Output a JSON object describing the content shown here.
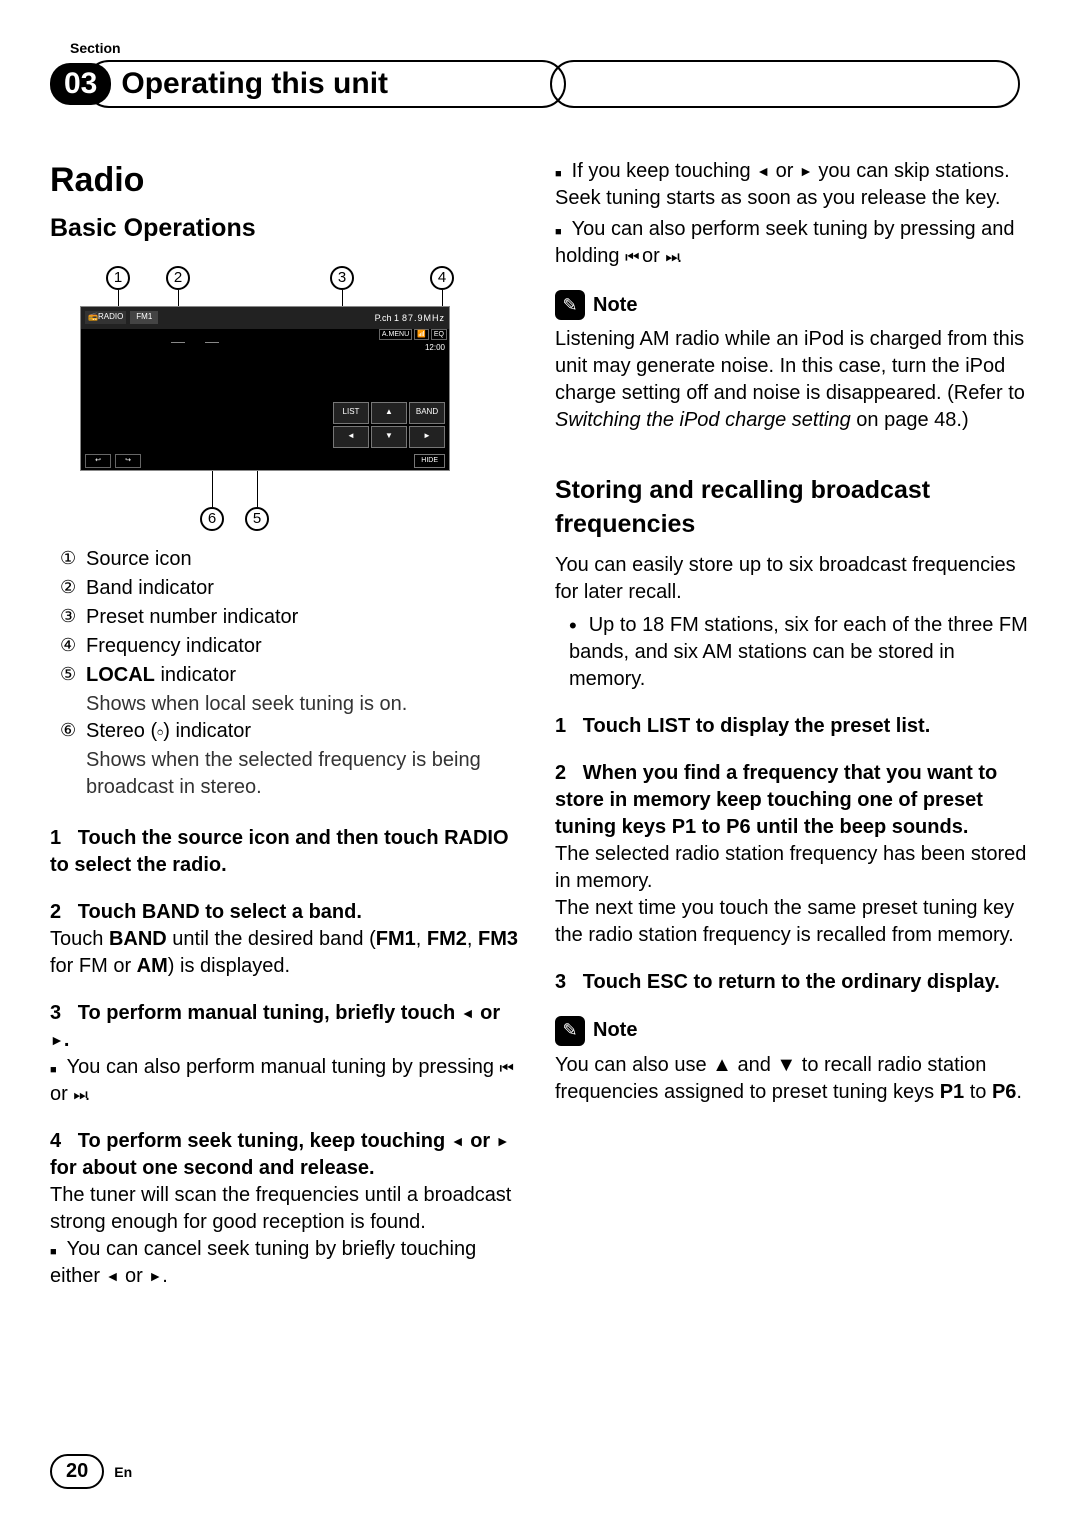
{
  "header": {
    "section_label": "Section",
    "chapter_num": "03",
    "chapter_title": "Operating this unit"
  },
  "left": {
    "title": "Radio",
    "subtitle": "Basic Operations",
    "screen": {
      "radio_label": "📻RADIO",
      "band_tab": "FM1",
      "pch_label": "P.ch 1",
      "freq": "87.9MHz",
      "menu1": "A.MENU",
      "menu2": "📶",
      "menu3": "EQ",
      "time": "12:00",
      "btn_list": "LIST",
      "btn_up": "▲",
      "btn_band": "BAND",
      "btn_left": "◄",
      "btn_down": "▼",
      "btn_right": "►",
      "btn_hide": "HIDE"
    },
    "callouts": {
      "c1": "1",
      "c2": "2",
      "c3": "3",
      "c4": "4",
      "c5": "5",
      "c6": "6"
    },
    "legend": [
      {
        "num": "①",
        "text": "Source icon"
      },
      {
        "num": "②",
        "text": "Band indicator"
      },
      {
        "num": "③",
        "text": "Preset number indicator"
      },
      {
        "num": "④",
        "text": "Frequency indicator"
      },
      {
        "num": "⑤",
        "bold": "LOCAL",
        "text": " indicator",
        "sub": "Shows when local seek tuning is on."
      },
      {
        "num": "⑥",
        "text": "Stereo (𝇈) indicator",
        "sub": "Shows when the selected frequency is being broadcast in stereo."
      }
    ],
    "step1": {
      "n": "1",
      "head": "Touch the source icon and then touch RADIO to select the radio."
    },
    "step2": {
      "n": "2",
      "head": "Touch BAND to select a band.",
      "body_pre": "Touch ",
      "body_b1": "BAND",
      "body_mid": " until the desired band (",
      "body_b2": "FM1",
      "body_sep1": ", ",
      "body_b3": "FM2",
      "body_sep2": ", ",
      "body_b4": "FM3",
      "body_mid2": " for FM or ",
      "body_b5": "AM",
      "body_end": ") is displayed."
    },
    "step3": {
      "n": "3",
      "head_pre": "To perform manual tuning, briefly touch ",
      "head_post": ".",
      "bullet_pre": "You can also perform manual tuning by pressing ",
      "bullet_post": "."
    },
    "step4": {
      "n": "4",
      "head_pre": "To perform seek tuning, keep touching ",
      "head_post": " for about one second and release.",
      "body": "The tuner will scan the frequencies until a broadcast strong enough for good reception is found.",
      "bullet_pre": "You can cancel seek tuning by briefly touching either ",
      "bullet_post": "."
    }
  },
  "right": {
    "cont_b1_pre": "If you keep touching ",
    "cont_b1_post": " you can skip stations. Seek tuning starts as soon as you release the key.",
    "cont_b2_pre": "You can also perform seek tuning by pressing and holding ",
    "cont_b2_post": ".",
    "note1": {
      "label": "Note",
      "body_pre": "Listening AM radio while an iPod is charged from this unit may generate noise. In this case, turn the iPod charge setting off and noise is disappeared. (Refer to ",
      "body_i": "Switching the iPod charge setting",
      "body_post": " on page 48.)"
    },
    "title2": "Storing and recalling broadcast frequencies",
    "intro": "You can easily store up to six broadcast frequencies for later recall.",
    "bullet": "Up to 18 FM stations, six for each of the three FM bands, and six AM stations can be stored in memory.",
    "step1": {
      "n": "1",
      "head": "Touch LIST to display the preset list."
    },
    "step2": {
      "n": "2",
      "head": "When you find a frequency that you want to store in memory keep touching one of preset tuning keys P1 to P6 until the beep sounds.",
      "body1": "The selected radio station frequency has been stored in memory.",
      "body2": "The next time you touch the same preset tuning key the radio station frequency is recalled from memory."
    },
    "step3": {
      "n": "3",
      "head": "Touch ESC to return to the ordinary display."
    },
    "note2": {
      "label": "Note",
      "body_pre": "You can also use ▲ and ▼ to recall radio station frequencies assigned to preset tuning keys ",
      "body_b1": "P1",
      "body_mid": " to ",
      "body_b2": "P6",
      "body_post": "."
    }
  },
  "footer": {
    "page": "20",
    "lang": "En"
  },
  "sym": {
    "left_tri": "◄",
    "right_tri": "►",
    "or": " or ",
    "skip_prev": "⏮",
    "skip_next": "⏭"
  }
}
